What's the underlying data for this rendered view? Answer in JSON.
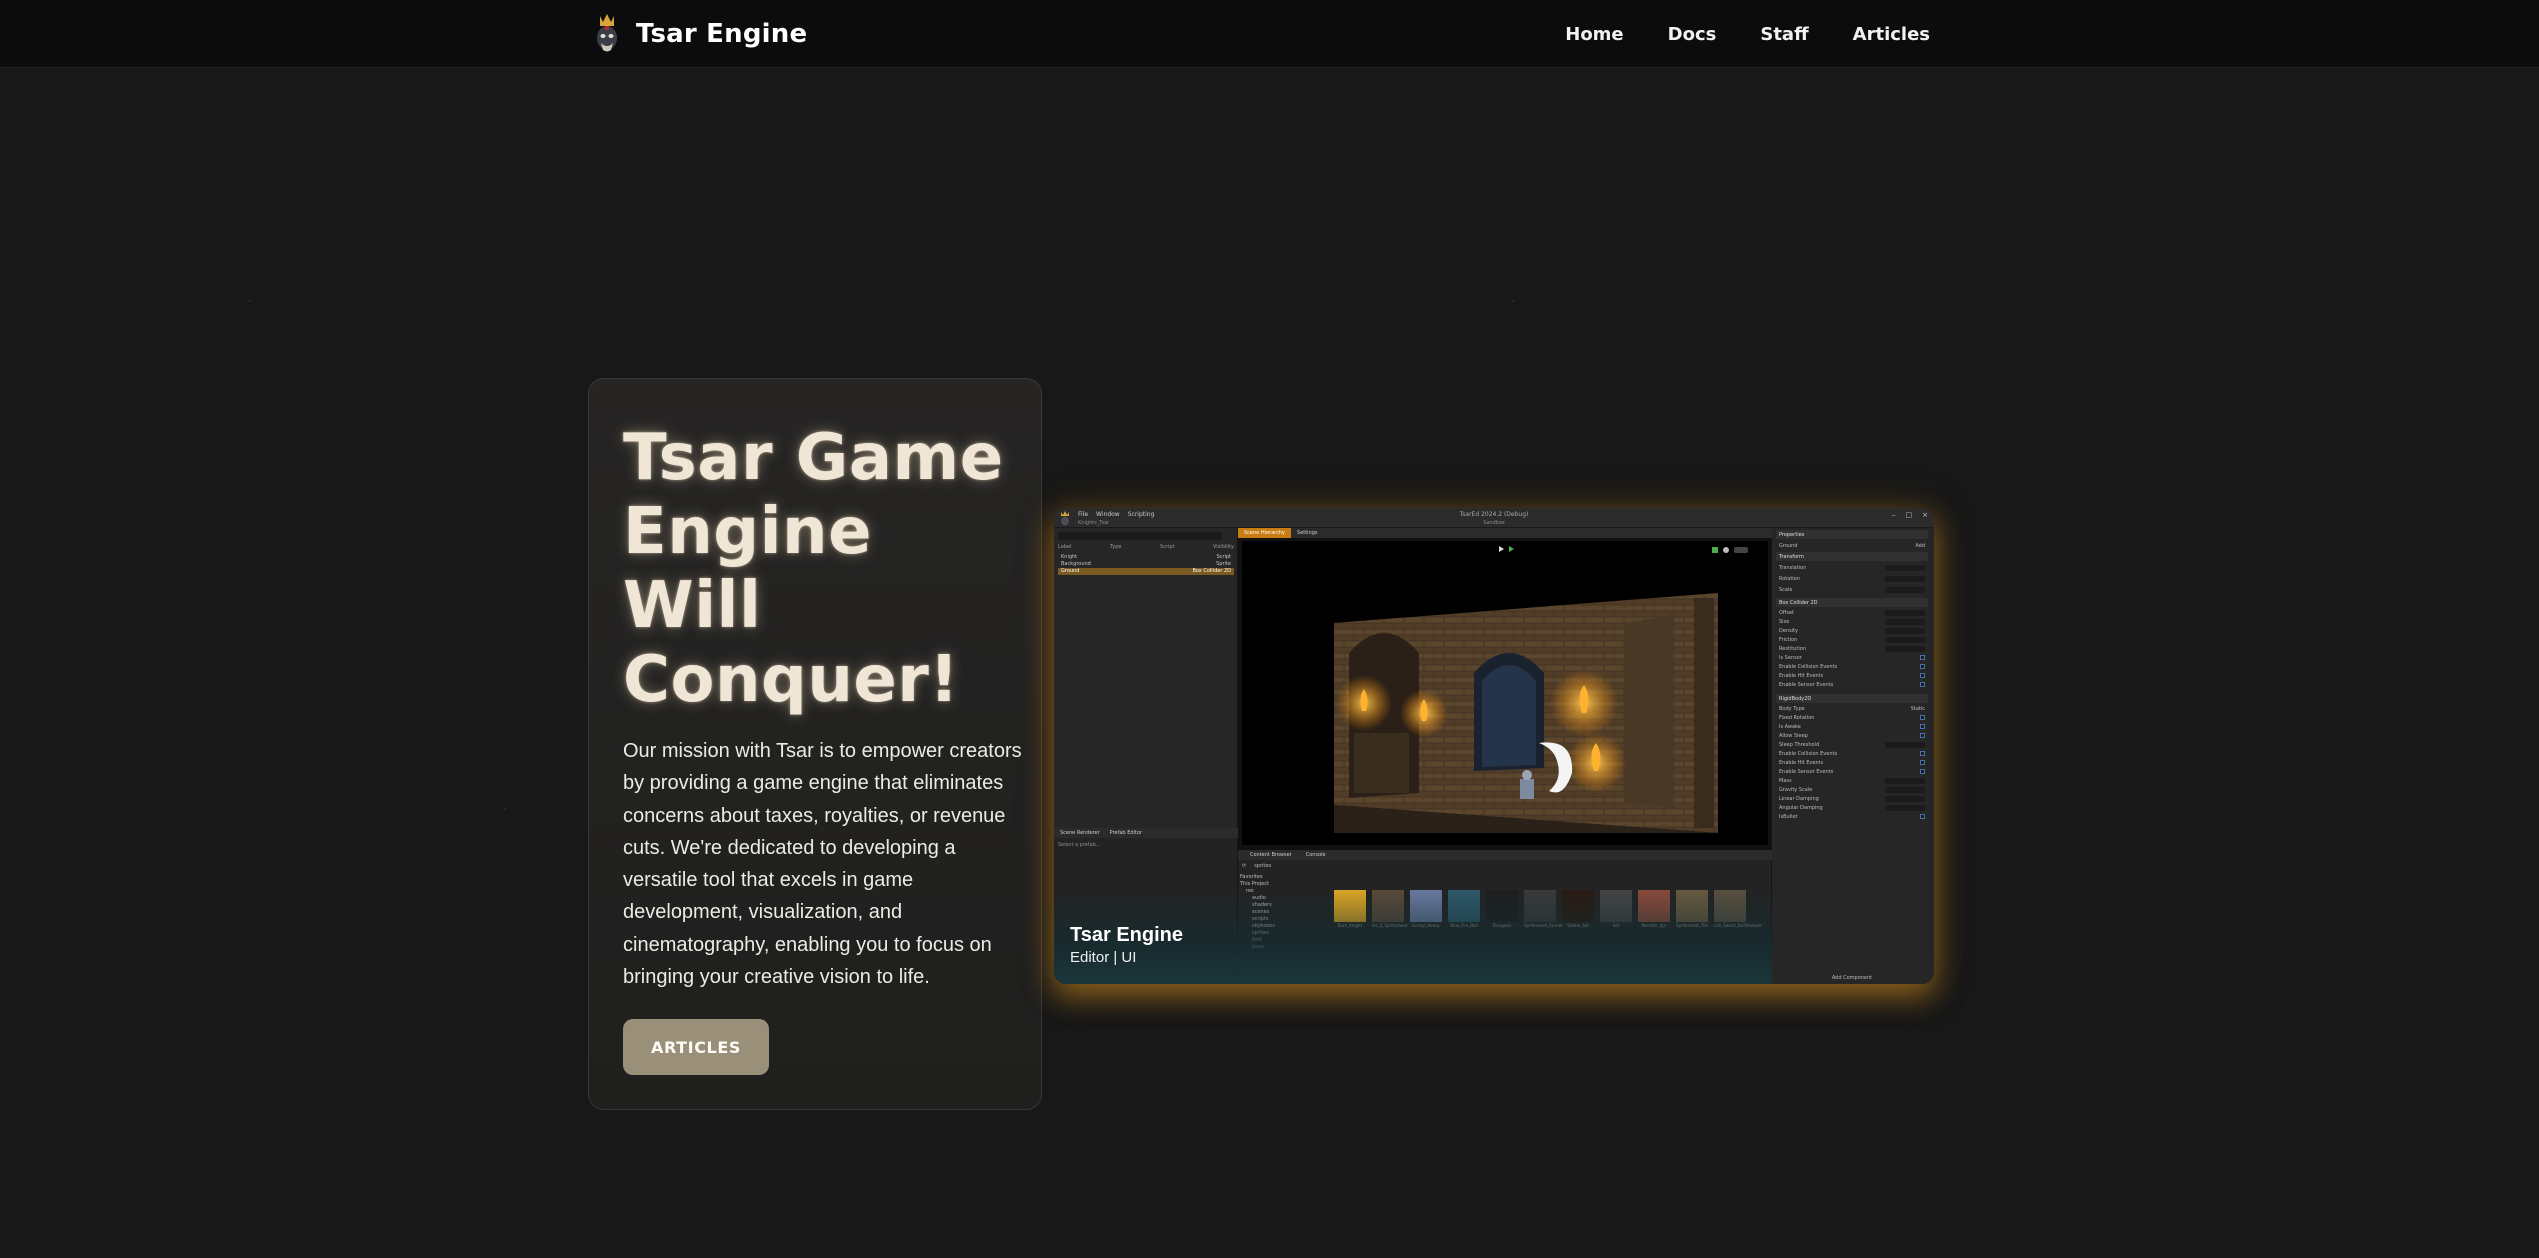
{
  "header": {
    "brand": "Tsar Engine",
    "nav": [
      "Home",
      "Docs",
      "Staff",
      "Articles"
    ]
  },
  "hero": {
    "title": "Tsar Game Engine Will Conquer!",
    "description": "Our mission with Tsar is to empower creators by providing a game engine that eliminates concerns about taxes, royalties, or revenue cuts. We're dedicated to developing a versatile tool that excels in game development, visualization, and cinematography, enabling you to focus on bringing your creative vision to life.",
    "button": "ARTICLES"
  },
  "showcase": {
    "caption_title": "Tsar Engine",
    "caption_sub": "Editor | UI",
    "editor": {
      "menu": [
        "File",
        "Window",
        "Scripting"
      ],
      "scene_name": "Knights_Tsar",
      "window_title": "TsarEd 2024.2 (Debug)",
      "window_sub": "Sandbox",
      "tree_headers": [
        "Label",
        "Type",
        "Script",
        "Visibility"
      ],
      "tree_rows": [
        {
          "label": "Knight",
          "type": "Script"
        },
        {
          "label": "Background",
          "type": "Sprite"
        },
        {
          "label": "Ground",
          "type": "Box Collider 2D"
        }
      ],
      "viewport_tabs": [
        "Scene Hierarchy",
        "Settings"
      ],
      "lower_tabs": [
        "Scene Renderer",
        "Prefab Editor"
      ],
      "lower_note": "Select a prefab...",
      "browser_tabs": [
        "Content Browser",
        "Console"
      ],
      "browser_path": "sprites",
      "browser_tree": [
        "Favorites",
        "This Project",
        "res",
        "audio",
        "shaders",
        "scenes",
        "scripts",
        "skyboxes",
        "sprites",
        "font",
        "bees"
      ],
      "thumbs": [
        "Burn_Knight",
        "Ice_2_Spritesheet",
        "Evalsy_Heavy",
        "Blue_Fire_Ball",
        "Dungeon",
        "Spritesheet_Farmer",
        "Statue_Set",
        "Set",
        "Monster_Spr",
        "Spritesheet_Tile",
        "Life_Sword_Earthkeeper"
      ],
      "inspector": {
        "title": "Properties",
        "entity": "Ground",
        "add_label": "Add",
        "sections": [
          "Transform",
          "Box Collider 2D",
          "RigidBody2D"
        ],
        "transform_rows": [
          "Translation",
          "Rotation",
          "Scale"
        ],
        "collider_rows": [
          "Offset",
          "Size",
          "Density",
          "Friction",
          "Restitution",
          "Is Sensor",
          "Enable Collision Events",
          "Enable Hit Events",
          "Enable Sensor Events"
        ],
        "rigidbody_rows": [
          "Body Type",
          "Fixed Rotation",
          "Is Awake",
          "Allow Sleep",
          "Sleep Threshold",
          "Enable Collision Events",
          "Enable Hit Events",
          "Enable Sensor Events",
          "Mass",
          "Gravity Scale",
          "Linear Damping",
          "Angular Damping",
          "IsBullet"
        ],
        "body_type": "Static",
        "add_component": "Add Component"
      }
    }
  },
  "colors": {
    "background": "#181818",
    "header_bg": "#0c0c0c",
    "button_bg": "#9a8f78",
    "glow": "#d28c1e",
    "tab_active": "#c77d12"
  }
}
